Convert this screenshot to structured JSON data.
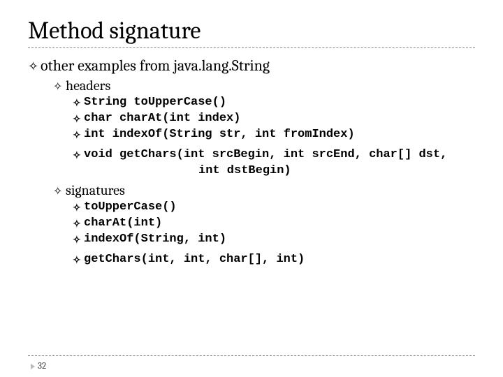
{
  "title": "Method signature",
  "lvl1": "other examples from java.lang.String",
  "headers_label": "headers",
  "signatures_label": "signatures",
  "headers": [
    "String toUpperCase()",
    "char charAt(int index)",
    "int indexOf(String str, int fromIndex)",
    "void getChars(int srcBegin, int srcEnd, char[] dst,"
  ],
  "headers_cont": "int dstBegin)",
  "signatures": [
    "toUpperCase()",
    "charAt(int)",
    "indexOf(String, int)",
    "getChars(int, int, char[], int)"
  ],
  "page_number": "32",
  "bullet_glyph": "✧"
}
